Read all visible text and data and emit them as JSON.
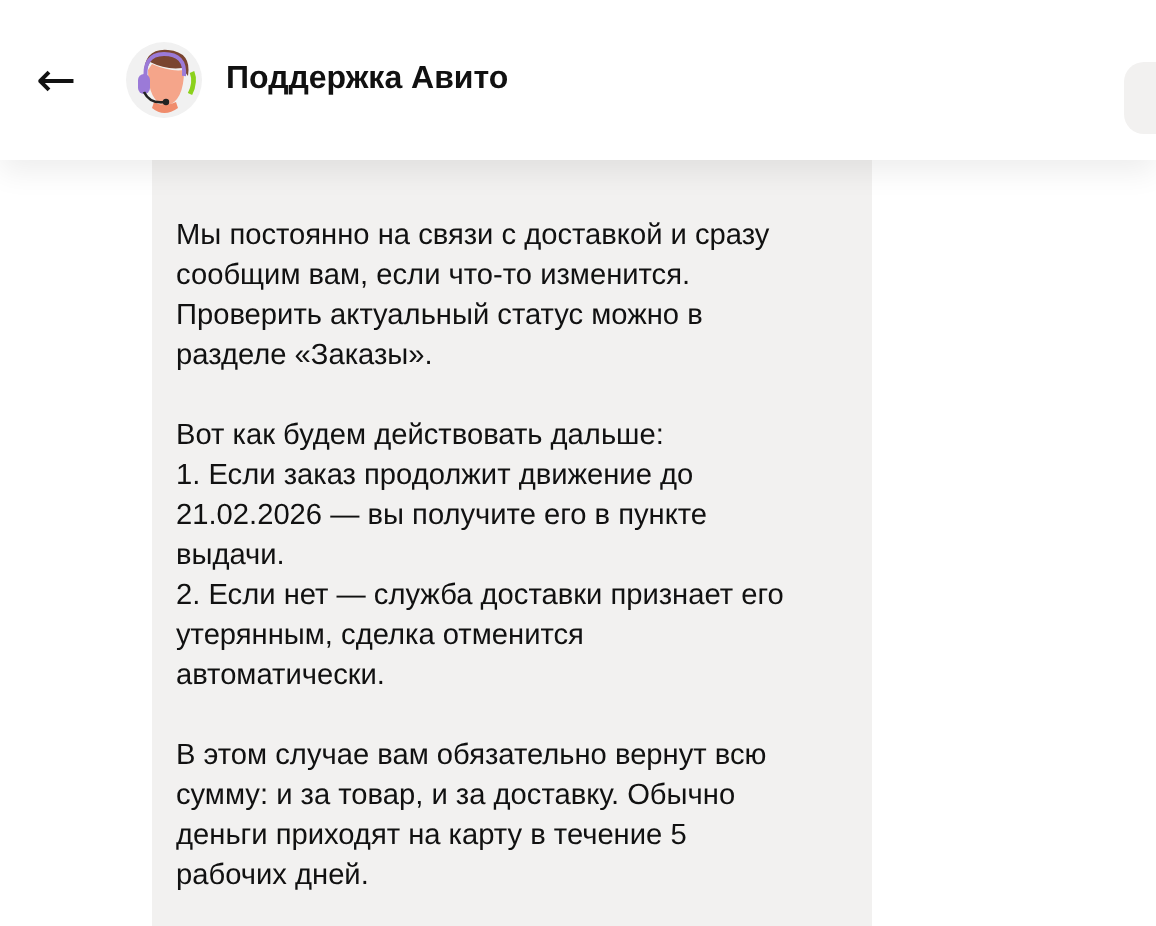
{
  "header": {
    "back": "←",
    "title": "Поддержка Авито"
  },
  "message": {
    "paragraphs": [
      {
        "kind": "text",
        "text": "Мы постоянно на связи с доставкой и сразу\nсообщим вам, если что-то изменится.\nПроверить актуальный статус можно в\nразделе «Заказы»."
      },
      {
        "kind": "list",
        "intro": "Вот как будем действовать дальше:",
        "items": [
          "1. Если заказ продолжит движение до\n21.02.2026 — вы получите его в пункте\nвыдачи.",
          "2. Если нет — служба доставки признает его\nутерянным, сделка отменится\nавтоматически."
        ]
      },
      {
        "kind": "text",
        "text": "В этом случае вам обязательно вернут всю\nсумму: и за товар, и за доставку. Обычно\nденьги приходят на карту в течение 5\nрабочих дней."
      }
    ]
  }
}
